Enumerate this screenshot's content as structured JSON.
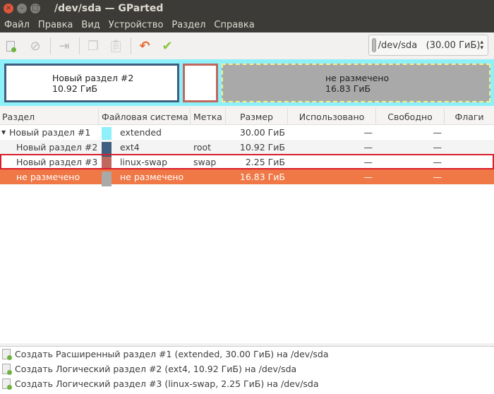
{
  "window": {
    "title": "/dev/sda — GParted"
  },
  "menu": [
    "Файл",
    "Правка",
    "Вид",
    "Устройство",
    "Раздел",
    "Справка"
  ],
  "device_selector": {
    "value": "/dev/sda   (30.00 ГиБ)"
  },
  "diskmap": {
    "p2": {
      "name": "Новый раздел #2",
      "size": "10.92 ГиБ"
    },
    "unalloc": {
      "name": "не размечено",
      "size": "16.83 ГиБ"
    }
  },
  "colors": {
    "extended": "#8ef0f8",
    "ext4": "#3e5f80",
    "linux-swap": "#c0675e",
    "unallocated": "#a9a9a9",
    "selection": "#f07746"
  },
  "table": {
    "headers": [
      "Раздел",
      "Файловая система",
      "Метка",
      "Размер",
      "Использовано",
      "Свободно",
      "Флаги"
    ],
    "rows": [
      {
        "partition": "Новый раздел #1",
        "fs": "extended",
        "label": "",
        "size": "30.00 ГиБ",
        "used": "—",
        "free": "—",
        "flags": "",
        "color": "#8ef0f8"
      },
      {
        "partition": "Новый раздел #2",
        "fs": "ext4",
        "label": "root",
        "size": "10.92 ГиБ",
        "used": "—",
        "free": "—",
        "flags": "",
        "color": "#3e5f80"
      },
      {
        "partition": "Новый раздел #3",
        "fs": "linux-swap",
        "label": "swap",
        "size": "2.25 ГиБ",
        "used": "—",
        "free": "—",
        "flags": "",
        "color": "#c0675e"
      },
      {
        "partition": "не размечено",
        "fs": "не размечено",
        "label": "",
        "size": "16.83 ГиБ",
        "used": "—",
        "free": "—",
        "flags": "",
        "color": "#a9a9a9"
      }
    ]
  },
  "operations": [
    "Создать Расширенный раздел #1 (extended, 30.00 ГиБ) на /dev/sda",
    "Создать Логический раздел #2 (ext4, 10.92 ГиБ) на /dev/sda",
    "Создать Логический раздел #3 (linux-swap, 2.25 ГиБ) на /dev/sda"
  ]
}
